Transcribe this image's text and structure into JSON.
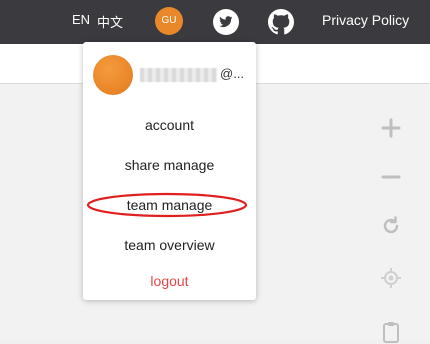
{
  "header": {
    "lang_en": "EN",
    "lang_zh": "中文",
    "user_initials": "GU",
    "privacy_policy": "Privacy Policy"
  },
  "user_menu": {
    "email_suffix": "@...",
    "items": [
      {
        "label": "account"
      },
      {
        "label": "share manage"
      },
      {
        "label": "team manage"
      },
      {
        "label": "team overview"
      },
      {
        "label": "logout"
      }
    ]
  },
  "colors": {
    "topbar": "#3a3a3f",
    "avatar": "#e8882a",
    "logout": "#e04848",
    "annotation": "#e02020"
  },
  "icons": [
    "twitter-icon",
    "github-icon",
    "zoom-in-icon",
    "zoom-out-icon",
    "refresh-icon",
    "locate-icon",
    "clipboard-icon"
  ]
}
